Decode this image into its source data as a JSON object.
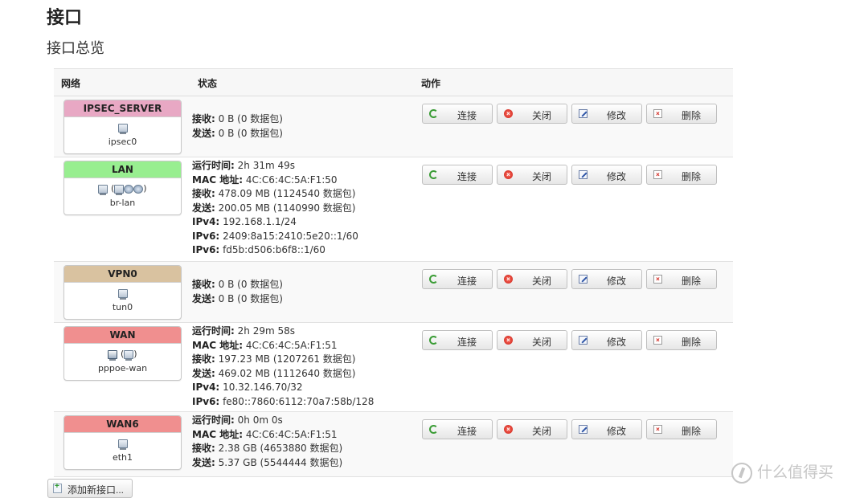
{
  "page": {
    "title": "接口",
    "section_title": "接口总览"
  },
  "table": {
    "headers": {
      "network": "网络",
      "status": "状态",
      "actions": "动作"
    }
  },
  "buttons": {
    "connect": "连接",
    "close": "关闭",
    "edit": "修改",
    "delete": "删除",
    "add": "添加新接口..."
  },
  "interfaces": [
    {
      "name": "IPSEC_SERVER",
      "device": "ipsec0",
      "header_color": "#e8a8c4",
      "icons": [
        "ethernet-port-icon"
      ],
      "status": [
        {
          "label": "接收:",
          "value": "0 B (0 数据包)"
        },
        {
          "label": "发送:",
          "value": "0 B (0 数据包)"
        }
      ]
    },
    {
      "name": "LAN",
      "device": "br-lan",
      "header_color": "#98ee90",
      "icons": [
        "bridge-icon",
        "ethernet-port-icon",
        "wireless-icon",
        "wireless-icon"
      ],
      "status": [
        {
          "label": "运行时间:",
          "value": "2h 31m 49s"
        },
        {
          "label": "MAC 地址:",
          "value": "4C:C6:4C:5A:F1:50"
        },
        {
          "label": "接收:",
          "value": "478.09 MB (1124540 数据包)"
        },
        {
          "label": "发送:",
          "value": "200.05 MB (1140990 数据包)"
        },
        {
          "label": "IPv4:",
          "value": "192.168.1.1/24"
        },
        {
          "label": "IPv6:",
          "value": "2409:8a15:2410:5e20::1/60"
        },
        {
          "label": "IPv6:",
          "value": "fd5b:d506:b6f8::1/60"
        }
      ]
    },
    {
      "name": "VPN0",
      "device": "tun0",
      "header_color": "#d9c2a0",
      "icons": [
        "ethernet-port-icon"
      ],
      "status": [
        {
          "label": "接收:",
          "value": "0 B (0 数据包)"
        },
        {
          "label": "发送:",
          "value": "0 B (0 数据包)"
        }
      ]
    },
    {
      "name": "WAN",
      "device": "pppoe-wan",
      "header_color": "#f08f8f",
      "icons": [
        "modem-icon",
        "ethernet-port-icon"
      ],
      "status": [
        {
          "label": "运行时间:",
          "value": "2h 29m 58s"
        },
        {
          "label": "MAC 地址:",
          "value": "4C:C6:4C:5A:F1:51"
        },
        {
          "label": "接收:",
          "value": "197.23 MB (1207261 数据包)"
        },
        {
          "label": "发送:",
          "value": "469.02 MB (1112640 数据包)"
        },
        {
          "label": "IPv4:",
          "value": "10.32.146.70/32"
        },
        {
          "label": "IPv6:",
          "value": "fe80::7860:6112:70a7:58b/128"
        }
      ]
    },
    {
      "name": "WAN6",
      "device": "eth1",
      "header_color": "#f08f8f",
      "icons": [
        "ethernet-port-icon"
      ],
      "status": [
        {
          "label": "运行时间:",
          "value": "0h 0m 0s"
        },
        {
          "label": "MAC 地址:",
          "value": "4C:C6:4C:5A:F1:51"
        },
        {
          "label": "接收:",
          "value": "2.38 GB (4653880 数据包)"
        },
        {
          "label": "发送:",
          "value": "5.37 GB (5544444 数据包)"
        }
      ]
    }
  ],
  "watermark": {
    "text": "什么值得买"
  }
}
